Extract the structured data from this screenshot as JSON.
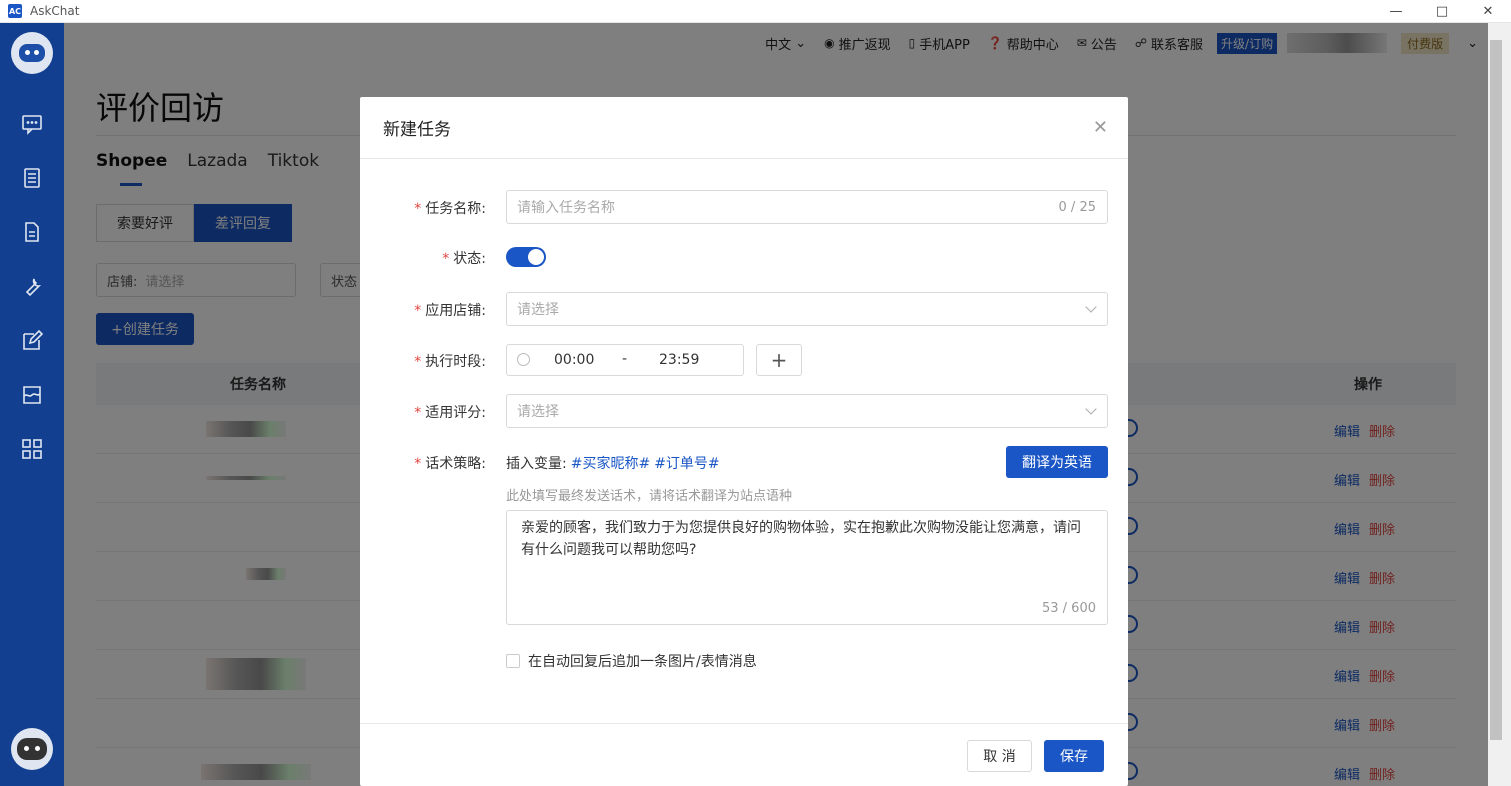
{
  "window": {
    "title": "AskChat",
    "app_icon": "AC"
  },
  "topnav": {
    "language": "中文",
    "referral": "推广返现",
    "mobile_app": "手机APP",
    "help": "帮助中心",
    "notice": "公告",
    "support": "联系客服",
    "upgrade": "升级/订购",
    "plan": "付费版"
  },
  "page": {
    "title": "评价回访",
    "platform_tabs": [
      "Shopee",
      "Lazada",
      "Tiktok"
    ],
    "sub_tabs": [
      "索要好评",
      "差评回复"
    ],
    "filter_shop_label": "店铺:",
    "filter_shop_placeholder": "请选择",
    "filter_status_label": "状态",
    "create_button": "+创建任务",
    "table_headers": {
      "name": "任务名称",
      "ops": "操作"
    },
    "edit_label": "编辑",
    "delete_label": "删除"
  },
  "modal": {
    "title": "新建任务",
    "task_name_label": "任务名称:",
    "task_name_placeholder": "请输入任务名称",
    "task_name_count": "0 / 25",
    "status_label": "状态:",
    "shop_label": "应用店铺:",
    "shop_placeholder": "请选择",
    "time_label": "执行时段:",
    "time_start": "00:00",
    "time_sep": "-",
    "time_end": "23:59",
    "rating_label": "适用评分:",
    "rating_placeholder": "请选择",
    "script_label": "话术策略:",
    "insert_var_label": "插入变量:",
    "var_buyer": "#买家昵称#",
    "var_order": "#订单号#",
    "translate_button": "翻译为英语",
    "hint": "此处填写最终发送话术，请将话术翻译为站点语种",
    "script_text": "亲爱的顾客，我们致力于为您提供良好的购物体验，实在抱歉此次购物没能让您满意，请问有什么问题我可以帮助您吗?",
    "script_count": "53 / 600",
    "append_checkbox": "在自动回复后追加一条图片/表情消息",
    "cancel_button": "取 消",
    "save_button": "保存"
  }
}
